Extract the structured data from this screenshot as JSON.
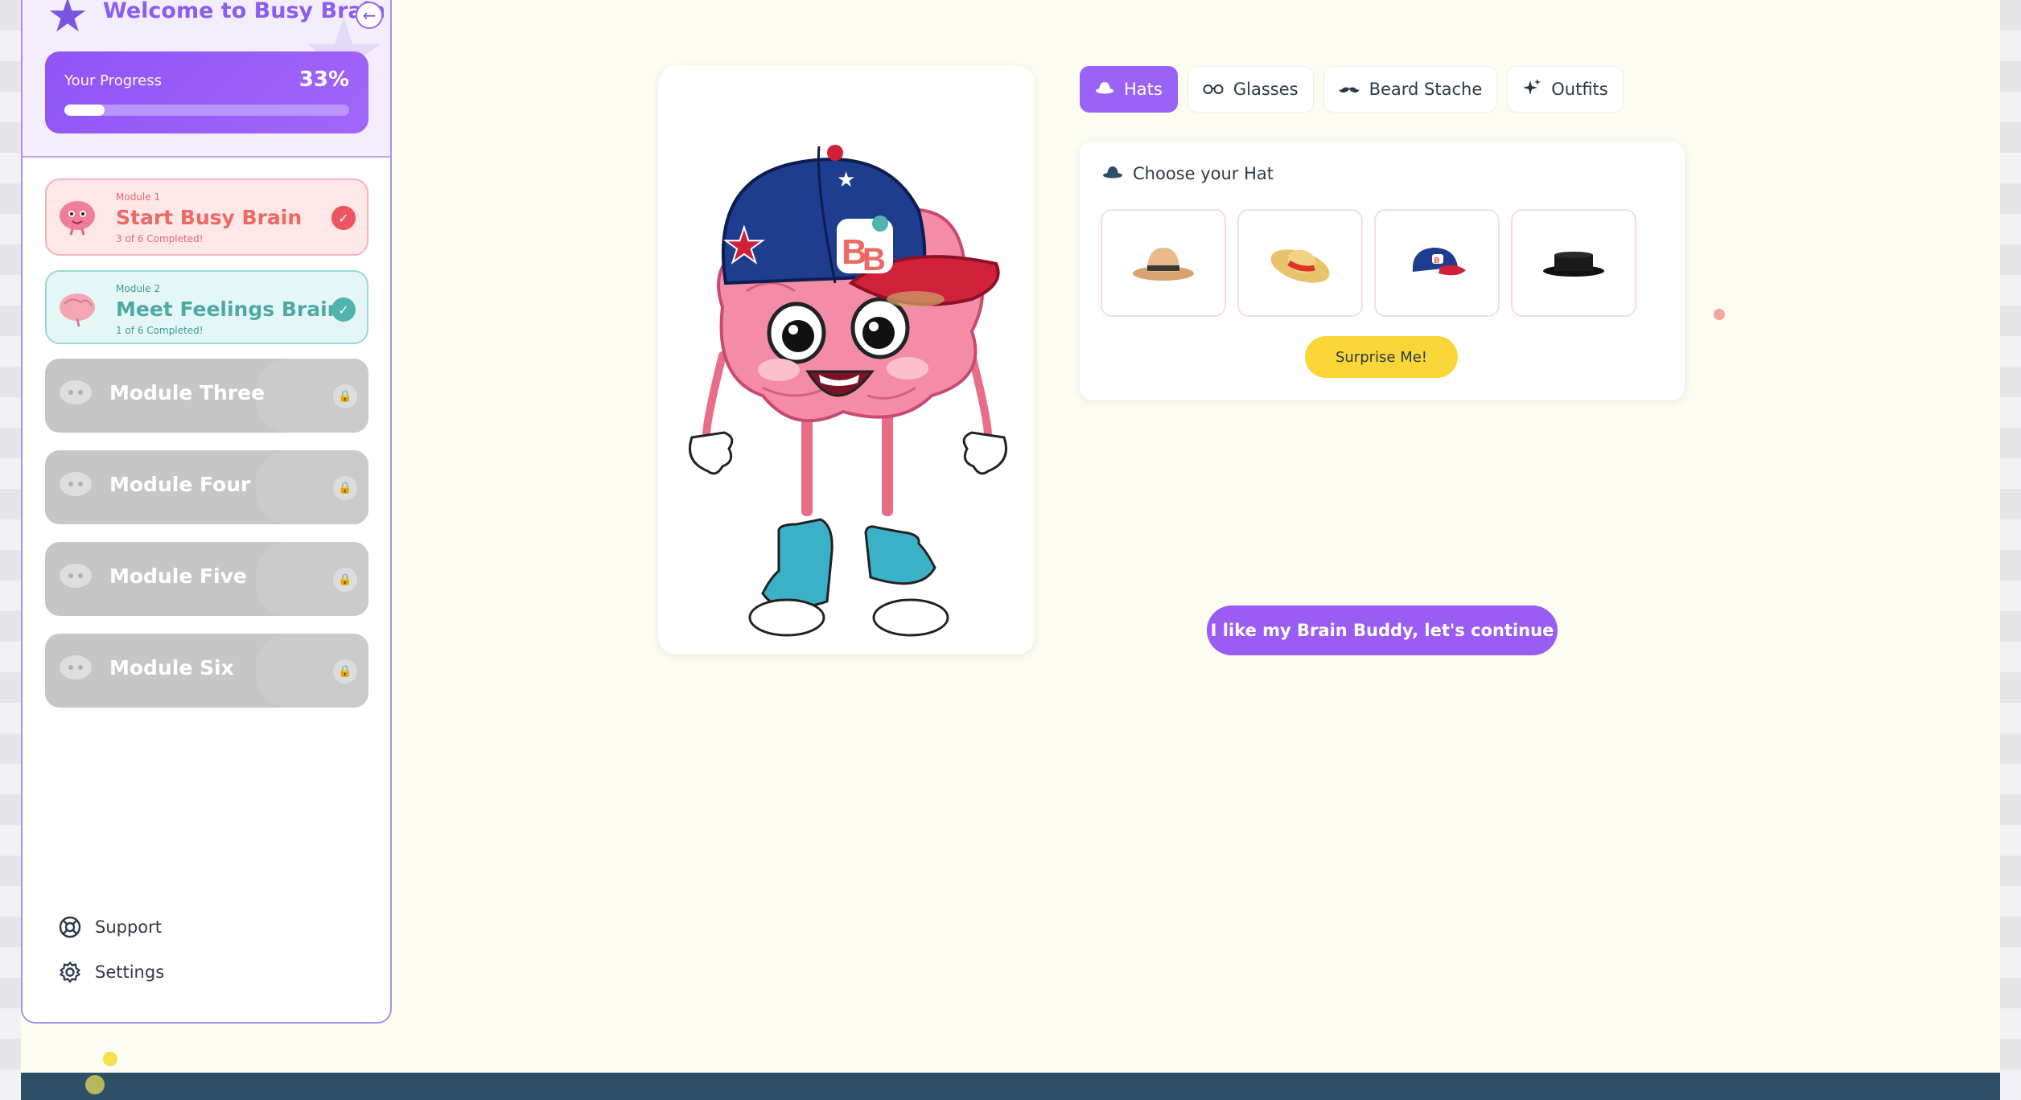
{
  "sidebar": {
    "welcome": "Welcome to Busy Brain",
    "progress": {
      "label": "Your Progress",
      "value_text": "33%",
      "fraction": 0.14
    },
    "modules": [
      {
        "small": "Module 1",
        "title": "Start Busy Brain",
        "sub": "3 of 6 Completed!",
        "state": "completed"
      },
      {
        "small": "Module 2",
        "title": "Meet Feelings Brain",
        "sub": "1 of 6 Completed!",
        "state": "completed"
      },
      {
        "title": "Module Three",
        "state": "locked"
      },
      {
        "title": "Module Four",
        "state": "locked"
      },
      {
        "title": "Module Five",
        "state": "locked"
      },
      {
        "title": "Module Six",
        "state": "locked"
      }
    ],
    "links": {
      "support": "Support",
      "settings": "Settings"
    }
  },
  "tabs": [
    "Hats",
    "Glasses",
    "Beard Stache",
    "Outfits"
  ],
  "hat_panel": {
    "title": "Choose your Hat",
    "options": [
      "cowboy-hat",
      "straw-hat",
      "baseball-cap",
      "top-hat"
    ],
    "surprise_label": "Surprise Me!"
  },
  "continue_label": "I like my Brain Buddy, let's continue",
  "colors": {
    "accent": "#9a63f6",
    "coral": "#ec6a63",
    "teal": "#4fa9a3",
    "yellow": "#fad737",
    "footer": "#2f4f66"
  }
}
